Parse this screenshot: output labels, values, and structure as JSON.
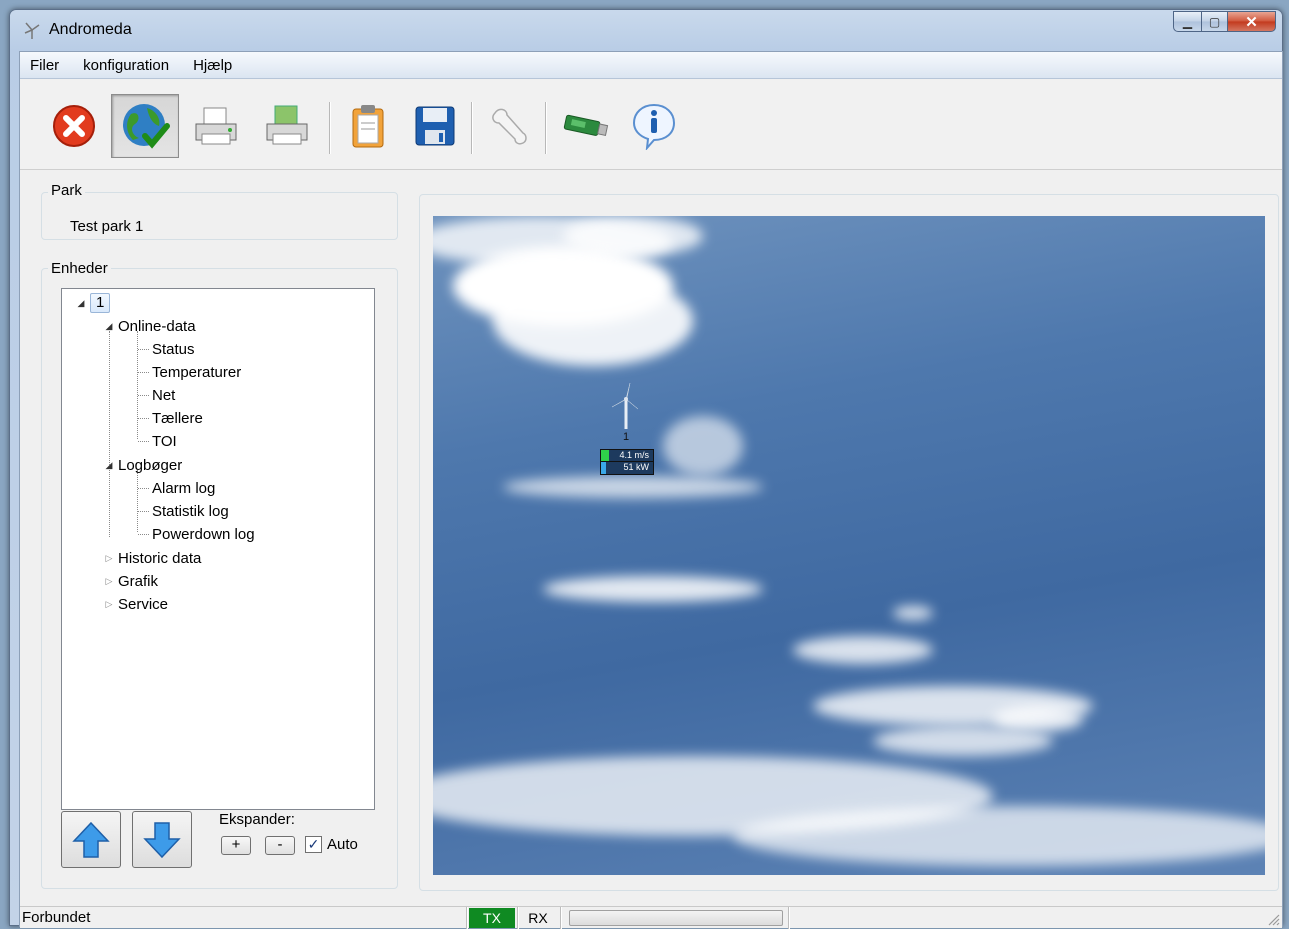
{
  "window": {
    "title": "Andromeda"
  },
  "menu": {
    "items": [
      "Filer",
      "konfiguration",
      "Hjælp"
    ]
  },
  "toolbar": {
    "buttons": [
      "close-connection-icon",
      "connect-globe-icon",
      "printer-icon",
      "print-preview-icon",
      "clipboard-icon",
      "save-icon",
      "wrench-icon",
      "usb-stick-icon",
      "info-icon"
    ]
  },
  "park": {
    "title": "Park",
    "name": "Test park 1"
  },
  "units": {
    "title": "Enheder",
    "root": "1",
    "groups": [
      {
        "label": "Online-data",
        "expanded": true,
        "children": [
          "Status",
          "Temperaturer",
          "Net",
          "Tællere",
          "TOI"
        ]
      },
      {
        "label": "Logbøger",
        "expanded": true,
        "children": [
          "Alarm log",
          "Statistik log",
          "Powerdown log"
        ]
      },
      {
        "label": "Historic data",
        "expanded": false
      },
      {
        "label": "Grafik",
        "expanded": false
      },
      {
        "label": "Service",
        "expanded": false
      }
    ]
  },
  "expand": {
    "label": "Ekspander:",
    "plus": "+",
    "minus": "-",
    "auto_label": "Auto",
    "auto_checked": true
  },
  "map": {
    "turbine_id": "1",
    "wind_speed": "4.1 m/s",
    "wind_fraction": 0.15,
    "power": "51 kW",
    "power_fraction": 0.1
  },
  "status": {
    "text": "Forbundet",
    "tx": "TX",
    "rx": "RX",
    "tx_color": "#0f8a22"
  }
}
